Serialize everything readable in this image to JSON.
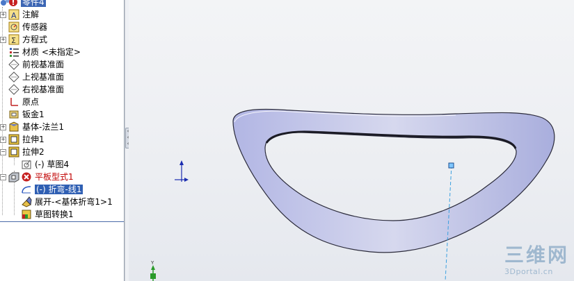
{
  "feature_tree": {
    "part_name": "零件4",
    "items": [
      {
        "label": "注解",
        "icon": "annotations-icon"
      },
      {
        "label": "传感器",
        "icon": "sensors-icon"
      },
      {
        "label": "方程式",
        "icon": "equations-icon"
      },
      {
        "label": "材质 <未指定>",
        "icon": "material-icon"
      },
      {
        "label": "前视基准面",
        "icon": "plane-icon"
      },
      {
        "label": "上视基准面",
        "icon": "plane-icon"
      },
      {
        "label": "右视基准面",
        "icon": "plane-icon"
      },
      {
        "label": "原点",
        "icon": "origin-icon"
      },
      {
        "label": "钣金1",
        "icon": "sheet-metal-icon"
      },
      {
        "label": "基体-法兰1",
        "icon": "base-flange-icon"
      },
      {
        "label": "拉伸1",
        "icon": "extrude-icon"
      },
      {
        "label": "拉伸2",
        "icon": "extrude-icon"
      },
      {
        "label": "(-) 草图4",
        "icon": "sketch-icon"
      },
      {
        "label": "平板型式1",
        "icon": "flat-pattern-icon"
      },
      {
        "label": "(-) 折弯-线1",
        "icon": "bend-line-icon"
      },
      {
        "label": "展开-<基体折弯1>1",
        "icon": "unfold-icon"
      },
      {
        "label": "草图转换1",
        "icon": "sketch-transform-icon"
      }
    ]
  },
  "viewport": {
    "watermark_main": "三维网",
    "watermark_sub": "3Dportal.cn",
    "triad_y_label": "Y"
  },
  "colors": {
    "selection": "#2f5fb3",
    "error_red": "#c00000",
    "part_face": "#b9bde6",
    "bend_line": "#3aa0e0"
  }
}
